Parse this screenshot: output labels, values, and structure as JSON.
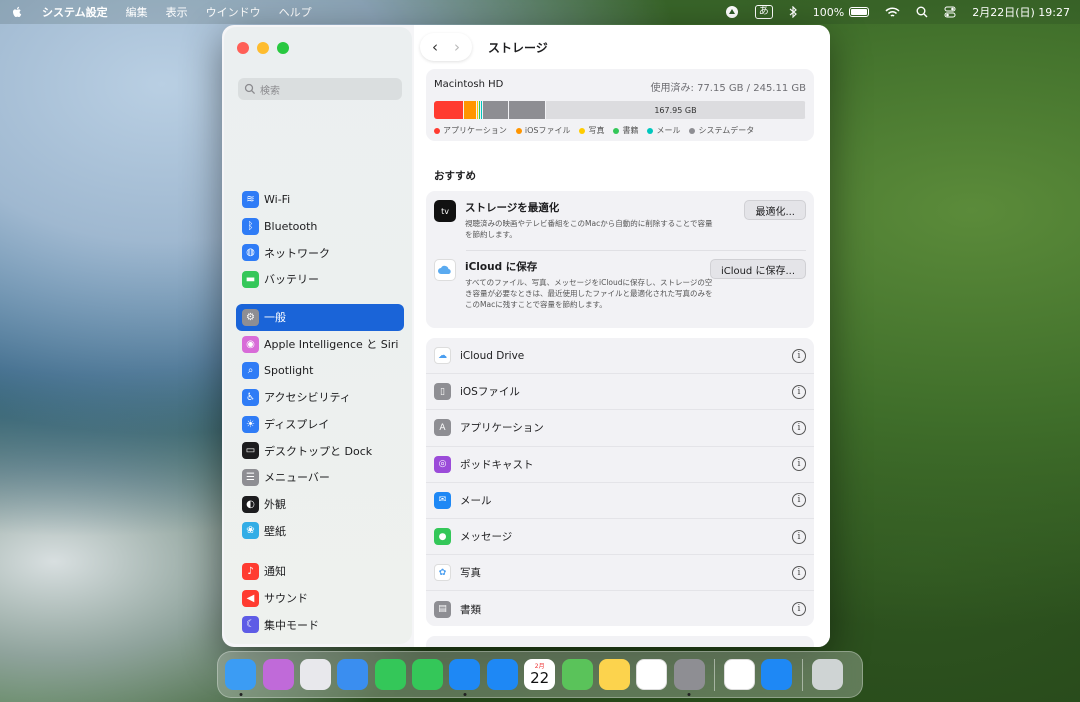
{
  "menubar": {
    "app_name": "システム設定",
    "menus": [
      "編集",
      "表示",
      "ウインドウ",
      "ヘルプ"
    ],
    "ime": "あ",
    "battery": "100%",
    "datetime": "2月22日(日) 19:27"
  },
  "sidebar": {
    "search_placeholder": "検索",
    "groups": [
      [
        {
          "label": "Wi-Fi",
          "icon": "wifi-icon",
          "color": "#2f7cf6"
        },
        {
          "label": "Bluetooth",
          "icon": "bluetooth-icon",
          "color": "#2f7cf6"
        },
        {
          "label": "ネットワーク",
          "icon": "network-globe-icon",
          "color": "#2f7cf6"
        },
        {
          "label": "バッテリー",
          "icon": "battery-icon",
          "color": "#34c759"
        }
      ],
      [
        {
          "label": "一般",
          "icon": "gear-icon",
          "color": "#8e8e93",
          "active": true
        },
        {
          "label": "Apple Intelligence と Siri",
          "icon": "siri-icon",
          "color": "#d86bd8"
        },
        {
          "label": "Spotlight",
          "icon": "magnifier-icon",
          "color": "#2f7cf6"
        },
        {
          "label": "アクセシビリティ",
          "icon": "accessibility-icon",
          "color": "#2f7cf6"
        },
        {
          "label": "ディスプレイ",
          "icon": "sun-icon",
          "color": "#2f7cf6"
        },
        {
          "label": "デスクトップと Dock",
          "icon": "desktop-dock-icon",
          "color": "#1c1c1e"
        },
        {
          "label": "メニューバー",
          "icon": "menubar-icon",
          "color": "#8e8e93"
        },
        {
          "label": "外観",
          "icon": "appearance-icon",
          "color": "#1c1c1e"
        },
        {
          "label": "壁紙",
          "icon": "wallpaper-icon",
          "color": "#32ade6"
        }
      ],
      [
        {
          "label": "通知",
          "icon": "bell-icon",
          "color": "#ff3b30"
        },
        {
          "label": "サウンド",
          "icon": "speaker-icon",
          "color": "#ff3b30"
        },
        {
          "label": "集中モード",
          "icon": "moon-icon",
          "color": "#5e5ce6"
        }
      ]
    ]
  },
  "content": {
    "title": "ストレージ",
    "disk": {
      "name": "Macintosh HD",
      "used_text": "使用済み: 77.15 GB / 245.11 GB",
      "free_label": "167.95 GB",
      "segments": [
        {
          "name": "アプリケーション",
          "color": "#ff3b30",
          "fraction": 0.08
        },
        {
          "name": "iOSファイル",
          "color": "#ff9500",
          "fraction": 0.035
        },
        {
          "name": "写真",
          "color": "#ffcc00",
          "fraction": 0.006
        },
        {
          "name": "書籍",
          "color": "#34c759",
          "fraction": 0.005
        },
        {
          "name": "メール",
          "color": "#00c7be",
          "fraction": 0.005
        },
        {
          "name": "system-other-1",
          "color": "#8e8e93",
          "fraction": 0.07
        },
        {
          "name": "システムデータ",
          "color": "#8e8e93",
          "fraction": 0.1
        }
      ],
      "legend": [
        {
          "label": "アプリケーション",
          "color": "#ff3b30"
        },
        {
          "label": "iOSファイル",
          "color": "#ff9500"
        },
        {
          "label": "写真",
          "color": "#ffcc00"
        },
        {
          "label": "書籍",
          "color": "#34c759"
        },
        {
          "label": "メール",
          "color": "#00c7be"
        },
        {
          "label": "システムデータ",
          "color": "#8e8e93"
        }
      ]
    },
    "recommend_title": "おすすめ",
    "recommendations": [
      {
        "title": "ストレージを最適化",
        "desc": "視聴済みの映画やテレビ番組をこのMacから自動的に削除することで容量を節約します。",
        "button": "最適化...",
        "icon": "appletv-icon"
      },
      {
        "title": "iCloud に保存",
        "desc": "すべてのファイル、写真、メッセージをiCloudに保存し、ストレージの空き容量が必要なときは、最近使用したファイルと最適化された写真のみをこのMacに残すことで容量を節約します。",
        "button": "iCloud に保存...",
        "icon": "icloud-icon"
      }
    ],
    "items": [
      {
        "label": "iCloud Drive",
        "icon": "icloud-drive-icon",
        "color": "#ffffff"
      },
      {
        "label": "iOSファイル",
        "icon": "ios-files-icon",
        "color": "#8e8e93"
      },
      {
        "label": "アプリケーション",
        "icon": "applications-icon",
        "color": "#8e8e93"
      },
      {
        "label": "ポッドキャスト",
        "icon": "podcasts-icon",
        "color": "#9b4bd9"
      },
      {
        "label": "メール",
        "icon": "mail-icon",
        "color": "#1e88f5"
      },
      {
        "label": "メッセージ",
        "icon": "messages-icon",
        "color": "#34c759"
      },
      {
        "label": "写真",
        "icon": "photos-icon",
        "color": "#ffffff"
      },
      {
        "label": "書類",
        "icon": "documents-icon",
        "color": "#8e8e93"
      }
    ]
  },
  "dock": {
    "apps": [
      {
        "name": "finder-icon",
        "color": "#3b9cf4",
        "running": true
      },
      {
        "name": "siri-app-icon",
        "color": "#c06ad9"
      },
      {
        "name": "launchpad-icon",
        "color": "#e8e8ec"
      },
      {
        "name": "mail-app-icon",
        "color": "#3a8ef0"
      },
      {
        "name": "facetime-icon",
        "color": "#34c759"
      },
      {
        "name": "messages-app-icon",
        "color": "#34c759"
      },
      {
        "name": "safari-icon",
        "color": "#1e88f5",
        "running": true
      },
      {
        "name": "app-store-icon",
        "color": "#1e88f5"
      },
      {
        "name": "calendar-icon",
        "color": "#ffffff",
        "calendar_day": "22",
        "calendar_month": "2月"
      },
      {
        "name": "maps-icon",
        "color": "#5ac35a"
      },
      {
        "name": "notes-icon",
        "color": "#fcd34d"
      },
      {
        "name": "photos-app-icon",
        "color": "#ffffff"
      },
      {
        "name": "system-settings-icon",
        "color": "#8e8e93",
        "running": true
      }
    ],
    "recent": [
      {
        "name": "google-drive-icon",
        "color": "#ffffff"
      },
      {
        "name": "safari-download-icon",
        "color": "#1e88f5"
      }
    ],
    "trash": {
      "name": "trash-icon",
      "color": "#cfd4d4"
    }
  }
}
